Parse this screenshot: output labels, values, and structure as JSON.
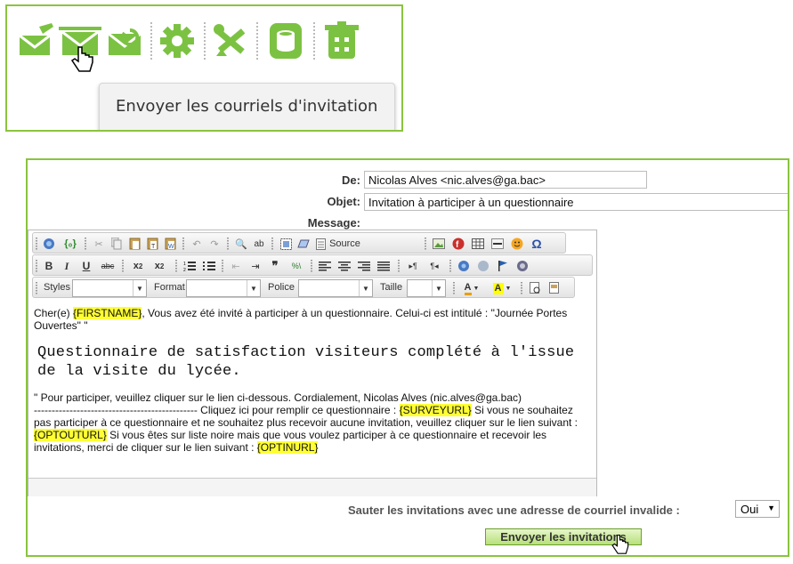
{
  "tooltip": {
    "text": "Envoyer les courriels d'invitation"
  },
  "toolbar_top": {
    "icons": [
      "edit-mail-icon",
      "send-mail-icon",
      "refresh-mail-icon",
      "gear-icon",
      "tools-icon",
      "database-icon",
      "trash-icon"
    ],
    "accent_color": "#7cc242"
  },
  "form": {
    "from_label": "De:",
    "from_value": "Nicolas Alves <nic.alves@ga.bac>",
    "subject_label": "Objet:",
    "subject_value": "Invitation à participer à un questionnaire",
    "message_label": "Message:"
  },
  "editor": {
    "source_label": "Source",
    "styles_label": "Styles",
    "format_label": "Format",
    "font_label": "Police",
    "size_label": "Taille",
    "body": {
      "p1_pre": "Cher(e) ",
      "p1_tag": "{FIRSTNAME}",
      "p1_post": ", Vous avez été invité à participer à un questionnaire. Celui-ci est intitulé : \"Journée Portes Ouvertes\" \"",
      "heading": "Questionnaire de satisfaction visiteurs complété à l'issue de la visite du lycée.",
      "p2_a": "\" Pour participer, veuillez cliquer sur le lien ci-dessous. Cordialement, Nicolas Alves (nic.alves@ga.bac)",
      "p2_b": "---------------------------------------------- Cliquez ici pour remplir ce questionnaire : ",
      "p2_tag1": "{SURVEYURL}",
      "p2_c": " Si vous ne souhaitez pas participer à ce questionnaire et ne souhaitez plus recevoir aucune invitation, veuillez cliquer sur le lien suivant : ",
      "p2_tag2": "{OPTOUTURL}",
      "p2_d": " Si vous êtes sur liste noire mais que vous voulez participer à ce questionnaire et recevoir les invitations, merci de cliquer sur le lien suivant : ",
      "p2_tag3": "{OPTINURL}"
    }
  },
  "skip": {
    "label": "Sauter les invitations avec une adresse de courriel invalide :",
    "value": "Oui"
  },
  "send_button": "Envoyer les invitations"
}
